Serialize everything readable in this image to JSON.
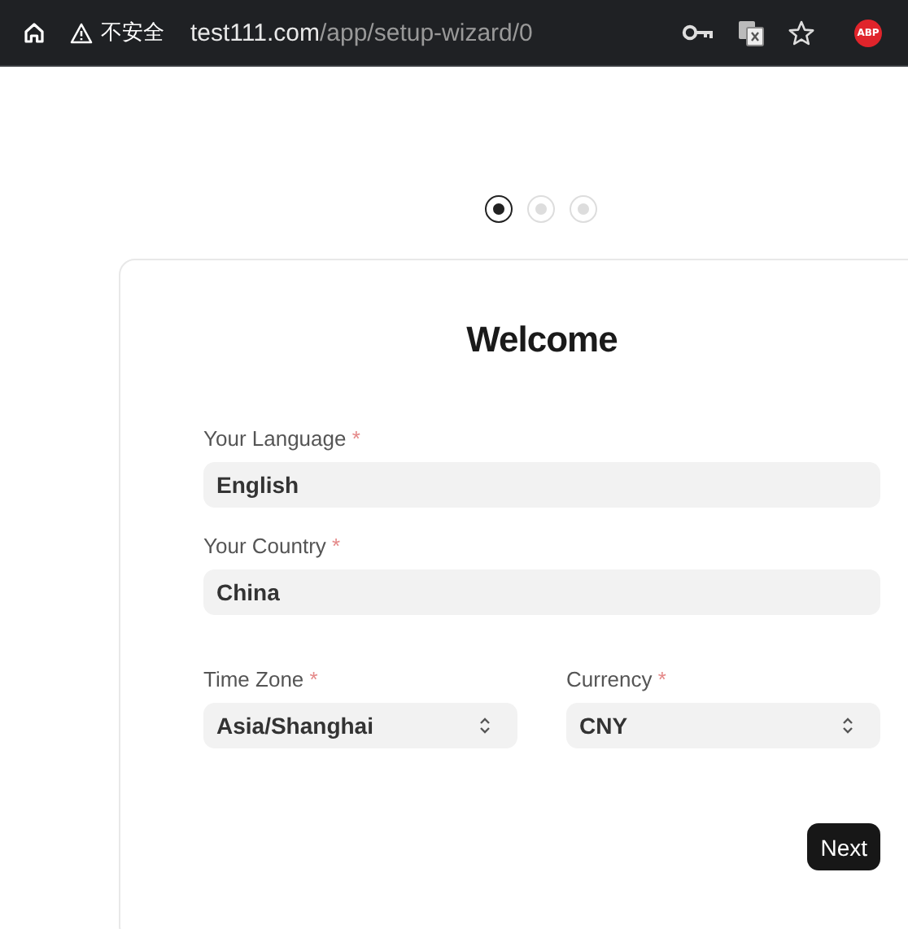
{
  "browser": {
    "security_warning": "不安全",
    "url_host": "test111.com",
    "url_path": "/app/setup-wizard/0",
    "extension_badge": "ABP"
  },
  "steps": [
    {
      "selected": true
    },
    {
      "selected": false
    },
    {
      "selected": false
    }
  ],
  "title": "Welcome",
  "fields": [
    {
      "label": "Your Language",
      "required_mark": "*",
      "value": "English",
      "kind": "text"
    },
    {
      "label": "Your Country",
      "required_mark": "*",
      "value": "China",
      "kind": "text"
    }
  ],
  "paired_fields": [
    {
      "label": "Time Zone",
      "required_mark": "*",
      "value": "Asia/Shanghai",
      "kind": "select"
    },
    {
      "label": "Currency",
      "required_mark": "*",
      "value": "CNY",
      "kind": "select"
    }
  ],
  "buttons": [
    {
      "label": "Next"
    }
  ]
}
